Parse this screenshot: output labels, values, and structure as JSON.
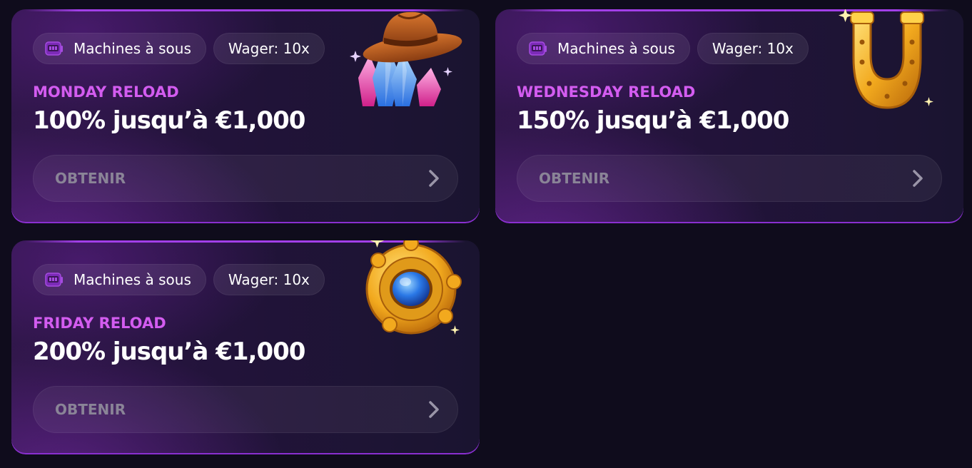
{
  "cards": [
    {
      "category_tag": "Machines à sous",
      "wager_tag": "Wager: 10x",
      "title": "MONDAY RELOAD",
      "offer": "100% jusqu’à €1,000",
      "button": "OBTENIR",
      "art_icon": "cowboy-hat-crystals-icon"
    },
    {
      "category_tag": "Machines à sous",
      "wager_tag": "Wager: 10x",
      "title": "WEDNESDAY RELOAD",
      "offer": "150% jusqu’à €1,000",
      "button": "OBTENIR",
      "art_icon": "golden-horseshoe-icon"
    },
    {
      "category_tag": "Machines à sous",
      "wager_tag": "Wager: 10x",
      "title": "FRIDAY RELOAD",
      "offer": "200% jusqu’à €1,000",
      "button": "OBTENIR",
      "art_icon": "golden-sapphire-amulet-icon"
    }
  ],
  "colors": {
    "background": "#0f0c1c",
    "accent_label": "#d35cf0",
    "card_border": "#a23fe8",
    "button_text": "#8a8497"
  }
}
